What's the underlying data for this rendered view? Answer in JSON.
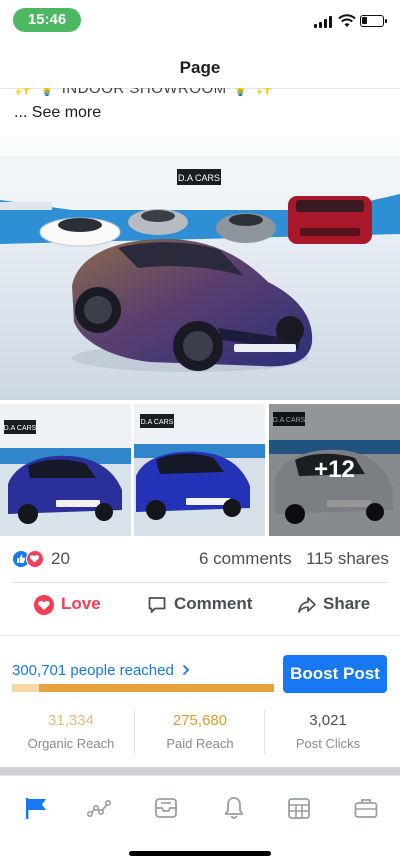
{
  "status_bar": {
    "time": "15:46"
  },
  "nav": {
    "title": "Page"
  },
  "post": {
    "text_line_partial": "✨ 💡 INDOOR SHOWROOM 💡 ✨",
    "see_more": "... See more"
  },
  "photos": {
    "main_sign": "D.A CARS",
    "thumb_sign": "D.A CARS",
    "more_count": "+12"
  },
  "engagement": {
    "reaction_count": "20",
    "comments": "6 comments",
    "shares": "115 shares"
  },
  "actions": {
    "love": "Love",
    "comment": "Comment",
    "share": "Share"
  },
  "insights": {
    "people_reached": "300,701 people reached",
    "boost_button": "Boost Post",
    "organic_fraction": 0.104,
    "organic_reach": "31,334",
    "organic_label": "Organic Reach",
    "paid_reach": "275,680",
    "paid_label": "Paid Reach",
    "post_clicks": "3,021",
    "post_clicks_label": "Post Clicks"
  },
  "tabs": [
    {
      "icon": "flag-icon",
      "active": true
    },
    {
      "icon": "insights-icon",
      "active": false
    },
    {
      "icon": "inbox-icon",
      "active": false
    },
    {
      "icon": "bell-icon",
      "active": false
    },
    {
      "icon": "calendar-icon",
      "active": false
    },
    {
      "icon": "briefcase-icon",
      "active": false
    }
  ],
  "colors": {
    "accent": "#1877f2",
    "love": "#f33e58",
    "status_green": "#4cb862",
    "organic": "#f7d8a9",
    "paid": "#e9a23b"
  }
}
